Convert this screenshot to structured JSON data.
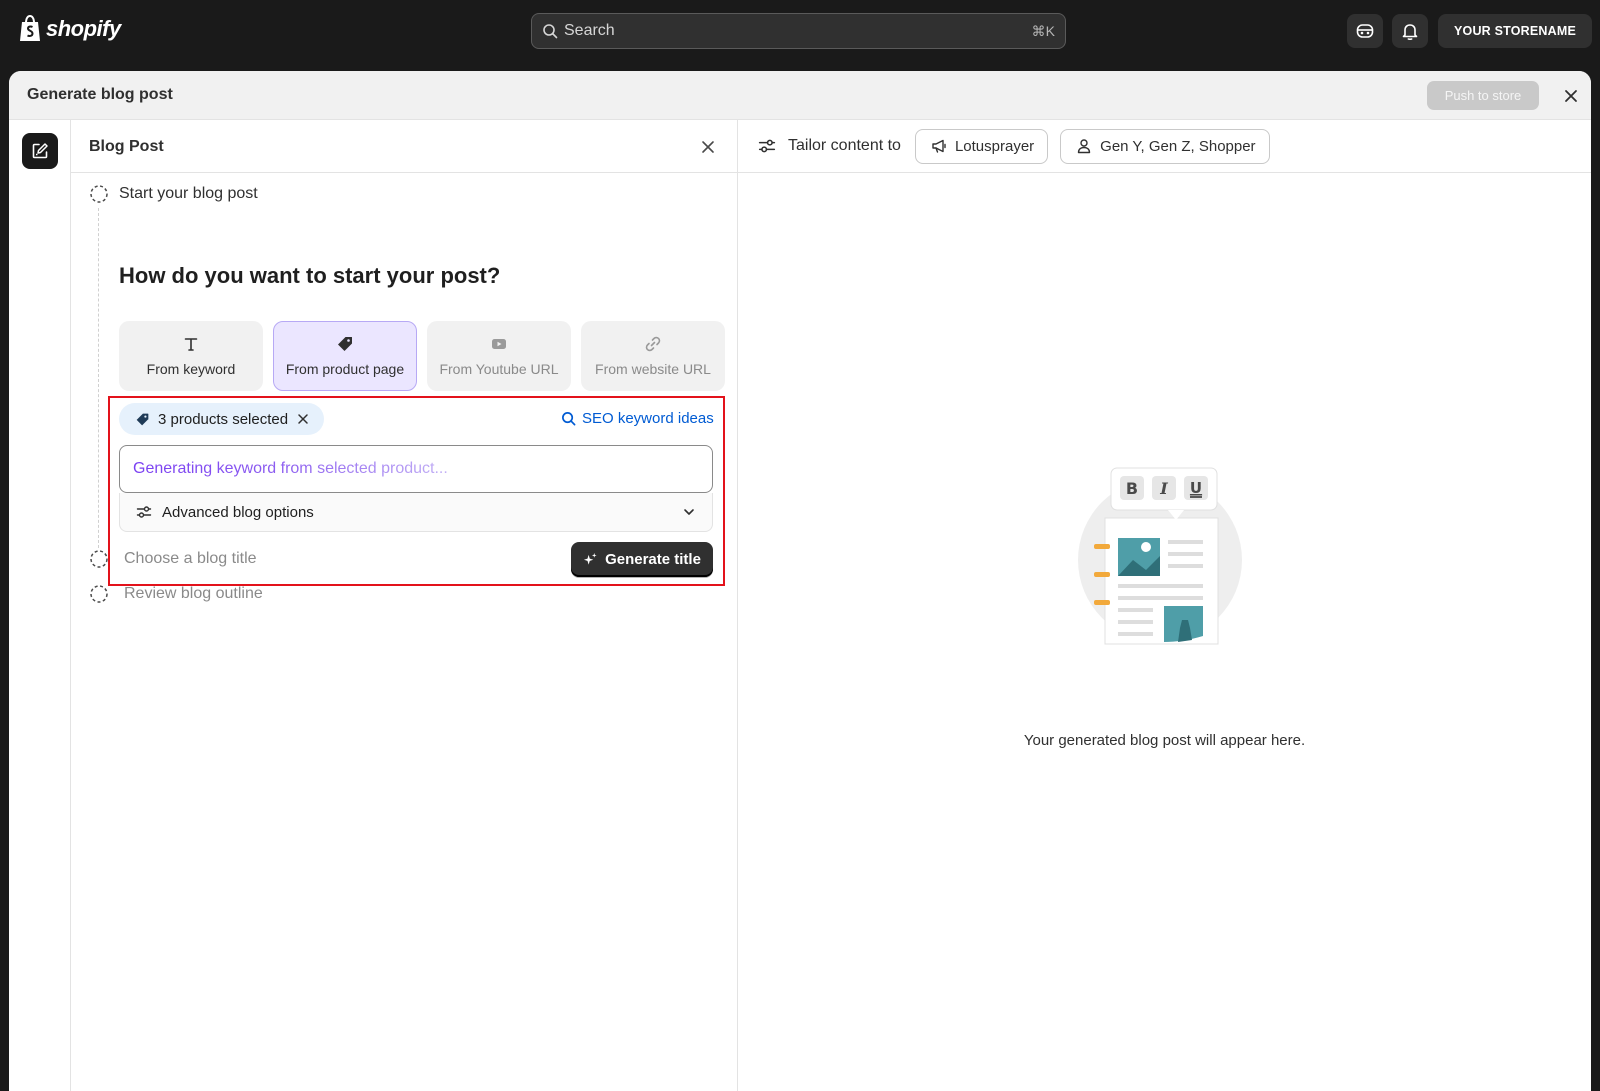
{
  "topbar": {
    "logo_text": "shopify",
    "search_placeholder": "Search",
    "search_shortcut": "⌘K",
    "store_label": "YOUR STORENAME"
  },
  "modal": {
    "title": "Generate blog post",
    "push_label": "Push to store"
  },
  "left_panel": {
    "title": "Blog Post",
    "steps": [
      {
        "label": "Start your blog post",
        "state": "active"
      },
      {
        "label": "Choose a blog title",
        "state": "pending"
      },
      {
        "label": "Review blog outline",
        "state": "pending"
      }
    ],
    "question": "How do you want to start your post?",
    "options": [
      {
        "label": "From keyword",
        "icon": "text-icon",
        "state": "enabled"
      },
      {
        "label": "From product page",
        "icon": "tag-icon",
        "state": "selected"
      },
      {
        "label": "From Youtube URL",
        "icon": "play-icon",
        "state": "disabled"
      },
      {
        "label": "From website URL",
        "icon": "link-icon",
        "state": "disabled"
      }
    ],
    "chip_label": "3 products selected",
    "seo_link": "SEO keyword ideas",
    "keyword_value": "Generating keyword from selected product...",
    "advanced_label": "Advanced blog options",
    "generate_label": "Generate title"
  },
  "right_panel": {
    "tailor_label": "Tailor content to",
    "brand_pill": "Lotusprayer",
    "audience_pill": "Gen Y, Gen Z, Shopper",
    "empty_message": "Your generated blog post will appear here."
  },
  "colors": {
    "highlight_border": "#e3121b",
    "link": "#005bd3",
    "selected_option_bg": "#ebe6ff",
    "chip_bg": "#e6f1fc",
    "primary_button": "#303030"
  }
}
